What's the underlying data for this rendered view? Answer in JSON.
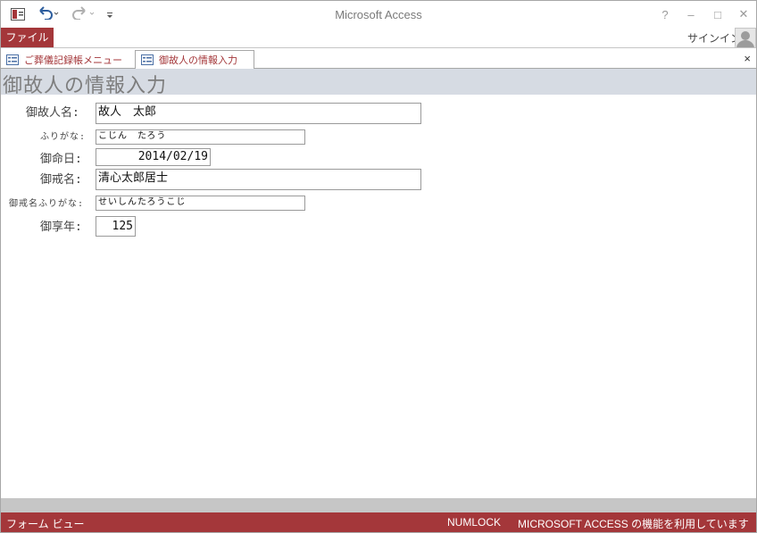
{
  "window": {
    "title": "Microsoft Access",
    "help": "?",
    "minimize": "–",
    "maximize": "□",
    "close": "✕"
  },
  "qat": {
    "app_icon": "access-app-icon",
    "undo_icon": "undo-icon",
    "redo_icon": "redo-icon",
    "customize_icon": "customize-qat-icon"
  },
  "ribbon": {
    "file_tab": "ファイル",
    "signin": "サインイン"
  },
  "document_tabs": [
    {
      "label": "ご葬儀記録帳メニュー",
      "active": false
    },
    {
      "label": "御故人の情報入力",
      "active": true
    }
  ],
  "document_close": "×",
  "form": {
    "title": "御故人の情報入力",
    "fields": {
      "name": {
        "label": "御故人名:",
        "value": "故人　太郎"
      },
      "name_kana": {
        "label": "ふりがな:",
        "value": "こじん　たろう"
      },
      "death_date": {
        "label": "御命日:",
        "value": "2014/02/19"
      },
      "posthumous_name": {
        "label": "御戒名:",
        "value": "清心太郎居士"
      },
      "posthumous_kana": {
        "label": "御戒名ふりがな:",
        "value": "せいしんたろうこじ"
      },
      "age": {
        "label": "御享年:",
        "value": "125"
      }
    }
  },
  "status": {
    "view": "フォーム ビュー",
    "numlock": "NUMLOCK",
    "message": "MICROSOFT ACCESS の機能を利用しています"
  },
  "colors": {
    "accent": "#a4373a",
    "header_band": "#d6dbe3"
  }
}
